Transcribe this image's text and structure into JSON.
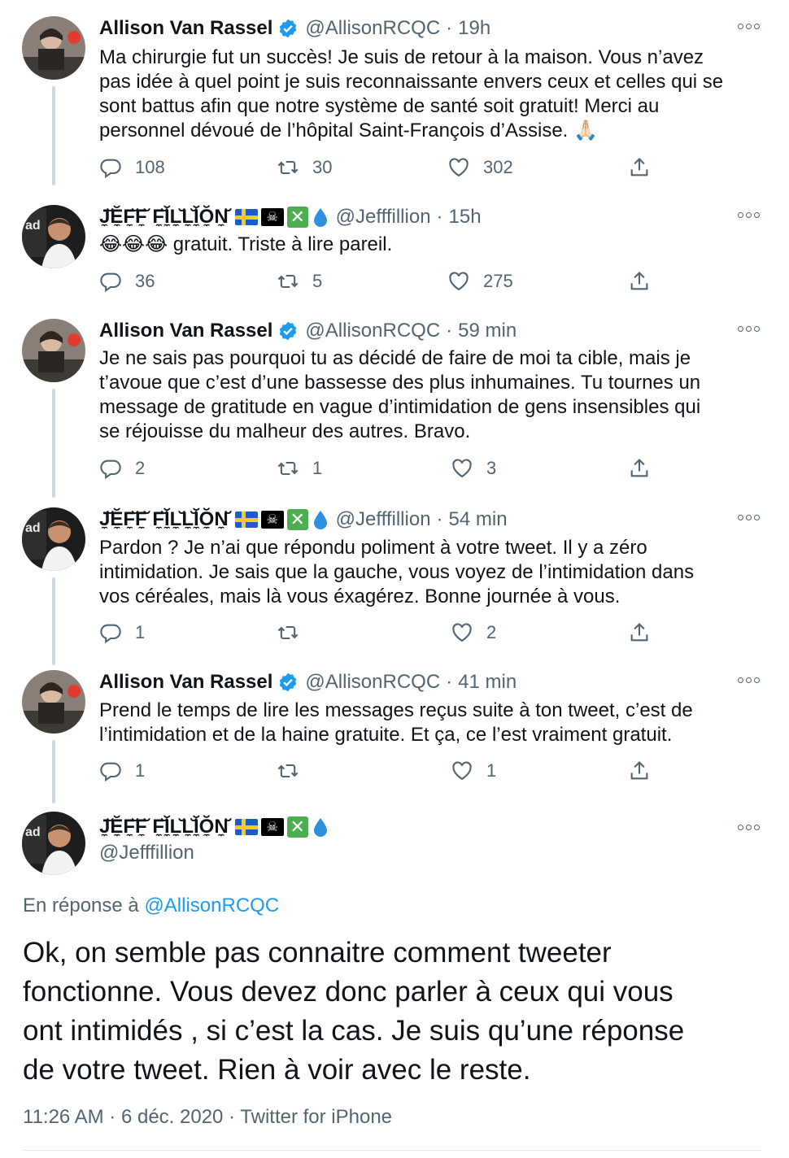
{
  "tweets": [
    {
      "name": "Allison Van Rassel",
      "verified": true,
      "handle": "@AllisonRCQC",
      "time": "19h",
      "lines": [
        "Ma chirurgie fut un succès! Je suis de retour à la maison. Vous n’avez",
        "pas idée à quel point je suis reconnaissante envers ceux et celles qui se",
        "sont battus afin que notre système de santé soit gratuit! Merci au",
        "personnel dévoué de l’hôpital Saint-François d’Assise. 🙏🏻"
      ],
      "replies": "108",
      "retweets": "30",
      "likes": "302"
    },
    {
      "name": "J̼̆Ĕ̼F̼̆F̼̆ F̼̆Ĭ̼L̼̆L̼̆Ĭ̼Ŏ̼N̼̆",
      "verified": false,
      "handle": "@Jefffillion",
      "time": "15h",
      "lines": [
        "😂😂😂 gratuit. Triste à lire pareil."
      ],
      "replies": "36",
      "retweets": "5",
      "likes": "275"
    },
    {
      "name": "Allison Van Rassel",
      "verified": true,
      "handle": "@AllisonRCQC",
      "time": "59 min",
      "lines": [
        "Je ne sais pas pourquoi tu as décidé de faire de moi ta cible, mais je",
        "t’avoue que c’est d’une bassesse des plus inhumaines. Tu tournes un",
        "message de gratitude en vague d’intimidation de gens insensibles qui",
        "se réjouisse du malheur des autres. Bravo."
      ],
      "replies": "2",
      "retweets": "1",
      "likes": "3"
    },
    {
      "name": "J̼̆Ĕ̼F̼̆F̼̆ F̼̆Ĭ̼L̼̆L̼̆Ĭ̼Ŏ̼N̼̆",
      "verified": false,
      "handle": "@Jefffillion",
      "time": "54 min",
      "lines": [
        "Pardon ? Je n’ai que répondu poliment à votre tweet. Il y a zéro",
        "intimidation. Je sais que la gauche, vous voyez de l’intimidation dans",
        "vos céréales, mais là vous éxagérez. Bonne journée à vous."
      ],
      "replies": "1",
      "retweets": "",
      "likes": "2"
    },
    {
      "name": "Allison Van Rassel",
      "verified": true,
      "handle": "@AllisonRCQC",
      "time": "41 min",
      "lines": [
        "Prend le temps de lire les messages reçus suite à ton tweet, c’est de",
        "l’intimidation et de la haine gratuite. Et ça, ce l’est vraiment gratuit."
      ],
      "replies": "1",
      "retweets": "",
      "likes": "1"
    }
  ],
  "main": {
    "name": "J̼̆Ĕ̼F̼̆F̼̆ F̼̆Ĭ̼L̼̆L̼̆Ĭ̼Ŏ̼N̼̆",
    "handle": "@Jefffillion",
    "reply_prefix": "En réponse à ",
    "reply_handle": "@AllisonRCQC",
    "lines": [
      "Ok, on semble pas connaitre comment tweeter",
      "fonctionne. Vous devez donc parler à ceux qui vous",
      "ont intimidés , si c’est la cas. Je suis qu’une réponse",
      "de votre tweet. Rien à voir avec le reste."
    ],
    "meta": "11:26 AM · 6 déc. 2020 · Twitter for iPhone"
  },
  "icons": {
    "verified": "verified-badge-icon",
    "reply": "reply-icon",
    "retweet": "retweet-icon",
    "like": "heart-icon",
    "share": "share-icon",
    "more": "more-icon",
    "drop": "droplet-icon"
  },
  "colors": {
    "accent": "#1d9bf0",
    "muted": "#536471",
    "thread": "#cfd9de"
  }
}
